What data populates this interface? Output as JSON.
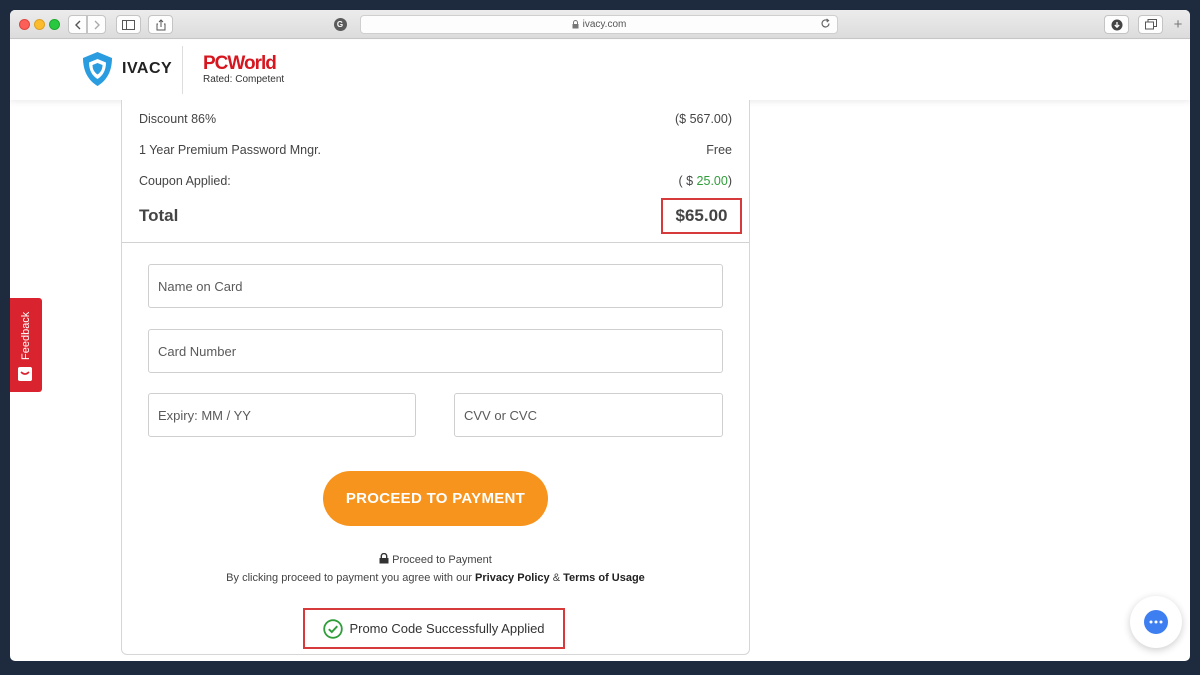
{
  "browser": {
    "url": "ivacy.com",
    "grammarly_letter": "G",
    "new_tab_symbol": "+"
  },
  "header": {
    "brand": "IVACY",
    "award_brand": "PCWorld",
    "award_rating": "Rated: Competent"
  },
  "order": {
    "discount": {
      "label": "Discount 86%",
      "value": "($ 567.00)"
    },
    "password_manager": {
      "label": "1 Year Premium Password Mngr.",
      "value": "Free"
    },
    "coupon": {
      "label": "Coupon Applied:",
      "value_prefix": "( $ ",
      "value_amount": "25.00",
      "value_suffix": ")"
    },
    "total": {
      "label": "Total",
      "value": "$65.00"
    }
  },
  "form": {
    "name_placeholder": "Name on Card",
    "card_placeholder": "Card Number",
    "expiry_placeholder": "Expiry: MM / YY",
    "cvv_placeholder": "CVV or CVC",
    "submit_label": "PROCEED TO PAYMENT",
    "secure_note": "Proceed to Payment",
    "agree_prefix": "By clicking proceed to payment you agree with our ",
    "privacy_link": "Privacy Policy",
    "agree_amp": " & ",
    "terms_link": "Terms of Usage"
  },
  "promo_message": "Promo Code Successfully Applied",
  "feedback_label": "Feedback",
  "colors": {
    "accent_orange": "#f7941e",
    "highlight_red": "#d63a3a",
    "coupon_green": "#2f9d3a",
    "feedback_red": "#d9232e",
    "chat_blue": "#3d7ff0"
  }
}
